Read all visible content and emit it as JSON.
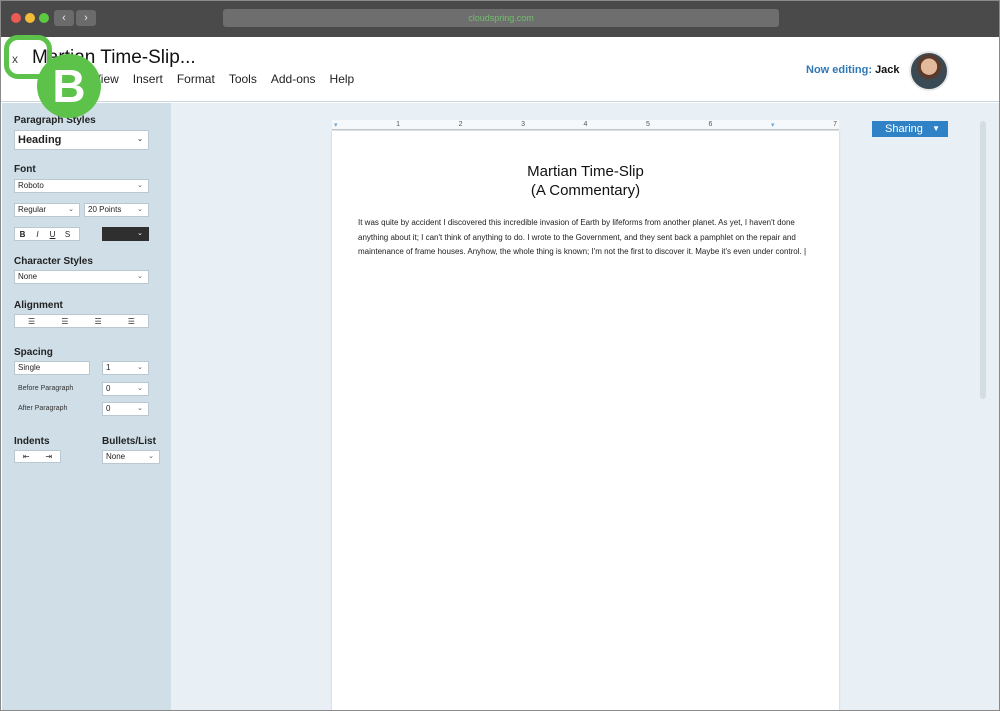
{
  "browser": {
    "url": "cloudspring.com",
    "back_icon": "‹",
    "forward_icon": "›"
  },
  "header": {
    "close_label": "x",
    "doc_title": "Martian Time-Slip...",
    "menu": [
      "View",
      "Insert",
      "Format",
      "Tools",
      "Add-ons",
      "Help"
    ],
    "editing_label": "Now editing:",
    "editing_user": "Jack"
  },
  "callout": {
    "letter": "B",
    "color": "#5cc24a"
  },
  "sidebar": {
    "paragraph_styles_label": "Paragraph Styles",
    "paragraph_style_value": "Heading",
    "font_label": "Font",
    "font_value": "Roboto",
    "font_weight_value": "Regular",
    "font_size_value": "20 Points",
    "format_buttons": [
      "B",
      "I",
      "U",
      "S"
    ],
    "font_color": "#2f2f2f",
    "character_styles_label": "Character Styles",
    "character_style_value": "None",
    "alignment_label": "Alignment",
    "alignment_icons": [
      "align-left-icon",
      "align-center-icon",
      "align-right-icon",
      "align-justify-icon"
    ],
    "spacing_label": "Spacing",
    "spacing_value": "Single",
    "spacing_count": "1",
    "before_paragraph_label": "Before Paragraph",
    "before_paragraph_value": "0",
    "after_paragraph_label": "After Paragraph",
    "after_paragraph_value": "0",
    "indents_label": "Indents",
    "bullets_label": "Bullets/List",
    "bullets_value": "None"
  },
  "ruler": [
    "1",
    "2",
    "3",
    "4",
    "5",
    "6",
    "7"
  ],
  "document": {
    "title_line1": "Martian Time-Slip",
    "title_line2": "(A Commentary)",
    "body": "It was quite by accident I discovered this incredible invasion of Earth by lifeforms from another planet. As yet, I haven't done anything about it; I can't think of anything to do. I wrote to the Government, and they sent back a pamphlet on the repair and maintenance of frame houses. Anyhow, the whole thing is known; I'm not the first to discover it. Maybe it's even under control."
  },
  "sharing": {
    "label": "Sharing",
    "color": "#2f82c6"
  },
  "colors": {
    "sidebar_bg": "#cfdee7",
    "canvas_bg": "#e9f0f5",
    "accent": "#2f78b7"
  }
}
